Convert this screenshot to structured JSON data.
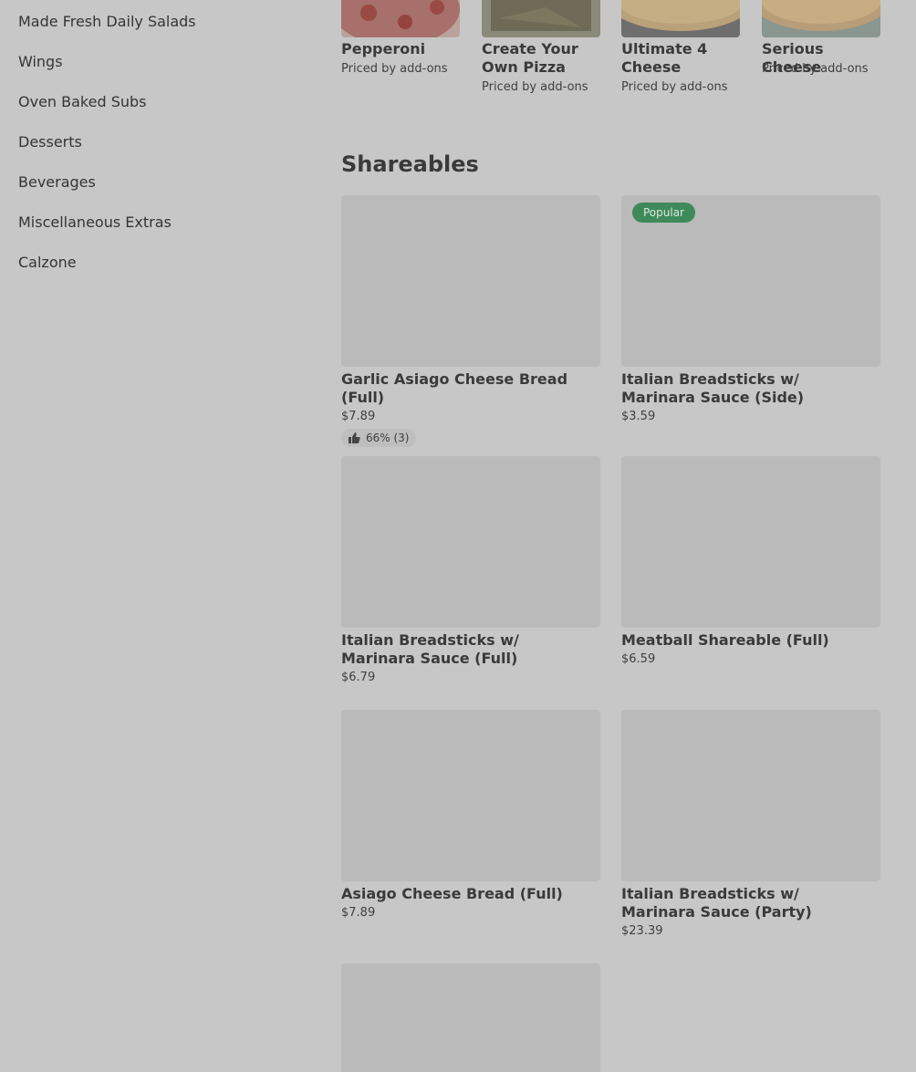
{
  "sidebar": {
    "items": [
      {
        "label": "Made Fresh Daily Salads"
      },
      {
        "label": "Wings"
      },
      {
        "label": "Oven Baked Subs"
      },
      {
        "label": "Desserts"
      },
      {
        "label": "Beverages"
      },
      {
        "label": "Miscellaneous Extras"
      },
      {
        "label": "Calzone"
      }
    ]
  },
  "pizzas": [
    {
      "name": "Pepperoni",
      "price": "Priced by add-ons"
    },
    {
      "name": "Create Your Own Pizza",
      "price": "Priced by add-ons"
    },
    {
      "name": "Ultimate 4 Cheese",
      "price": "Priced by add-ons"
    },
    {
      "name": "Serious Cheese",
      "price": "Priced by add-ons"
    }
  ],
  "shareables": {
    "title": "Shareables",
    "items": [
      {
        "name": "Garlic Asiago Cheese Bread (Full)",
        "price": "$7.89",
        "rating": "66% (3)"
      },
      {
        "name": "Italian Breadsticks w/ Marinara Sauce (Side)",
        "price": "$3.59",
        "badge": "Popular"
      },
      {
        "name": "Italian Breadsticks w/ Marinara Sauce (Full)",
        "price": "$6.79"
      },
      {
        "name": "Meatball Shareable (Full)",
        "price": "$6.59"
      },
      {
        "name": "Asiago Cheese Bread (Full)",
        "price": "$7.89"
      },
      {
        "name": "Italian Breadsticks w/ Marinara Sauce (Party)",
        "price": "$23.39"
      }
    ]
  },
  "colors": {
    "badge": "#3e8a5b",
    "overlay": "#c7c7c7"
  }
}
